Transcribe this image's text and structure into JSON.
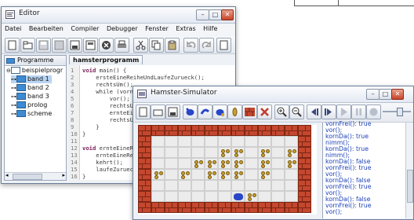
{
  "editor": {
    "title": "Editor",
    "menu": [
      "Datei",
      "Bearbeiten",
      "Compiler",
      "Debugger",
      "Fenster",
      "Extras",
      "Hilfe"
    ],
    "side_tab": "Programme",
    "tree": [
      {
        "label": "beispielprogr",
        "level": 0,
        "open": true
      },
      {
        "label": "band 1",
        "level": 1,
        "selected": true
      },
      {
        "label": "band 2",
        "level": 1
      },
      {
        "label": "band 3",
        "level": 1
      },
      {
        "label": "prolog",
        "level": 1
      },
      {
        "label": "scheme",
        "level": 1
      }
    ],
    "editor_tab": "hamsterprogramm",
    "code_lines": [
      {
        "n": "1",
        "kw": "void",
        "rest": " main() {"
      },
      {
        "n": "2",
        "kw": "",
        "rest": "    ersteEineReiheUndLaufeZurueck();"
      },
      {
        "n": "3",
        "kw": "",
        "rest": "    rechtsUm();"
      },
      {
        "n": "4",
        "kw": "",
        "rest": "    while (vornFrei()) {"
      },
      {
        "n": "5",
        "kw": "",
        "rest": "        vor();"
      },
      {
        "n": "6",
        "kw": "",
        "rest": "        rechtsUm();"
      },
      {
        "n": "7",
        "kw": "",
        "rest": "        ernteEineRei"
      },
      {
        "n": "8",
        "kw": "",
        "rest": "        rechtsUm();"
      },
      {
        "n": "9",
        "kw": "",
        "rest": "    }"
      },
      {
        "n": "10",
        "kw": "",
        "rest": "}"
      },
      {
        "n": "11",
        "kw": "",
        "rest": ""
      },
      {
        "n": "12",
        "kw": "void",
        "rest": " ernteEineReih"
      },
      {
        "n": "13",
        "kw": "",
        "rest": "    ernteEineReih"
      },
      {
        "n": "14",
        "kw": "",
        "rest": "    kehrt();"
      },
      {
        "n": "15",
        "kw": "",
        "rest": "    laufeZurueck("
      },
      {
        "n": "16",
        "kw": "",
        "rest": "}"
      }
    ]
  },
  "simulator": {
    "title": "Hamster-Simulator",
    "console": [
      "vornFrei(): true",
      "vor();",
      "kornDa(): true",
      "nimm();",
      "kornDa(): true",
      "nimm();",
      "kornDa(): false",
      "vornFrei(): true",
      "vor();",
      "kornDa(): false",
      "vornFrei(): true",
      "vor();",
      "kornDa(): false",
      "vornFrei(): true",
      "vor();"
    ],
    "colors": {
      "wall": "#c4472e",
      "grain": "#c9a030",
      "hamster": "#2746c8"
    }
  }
}
